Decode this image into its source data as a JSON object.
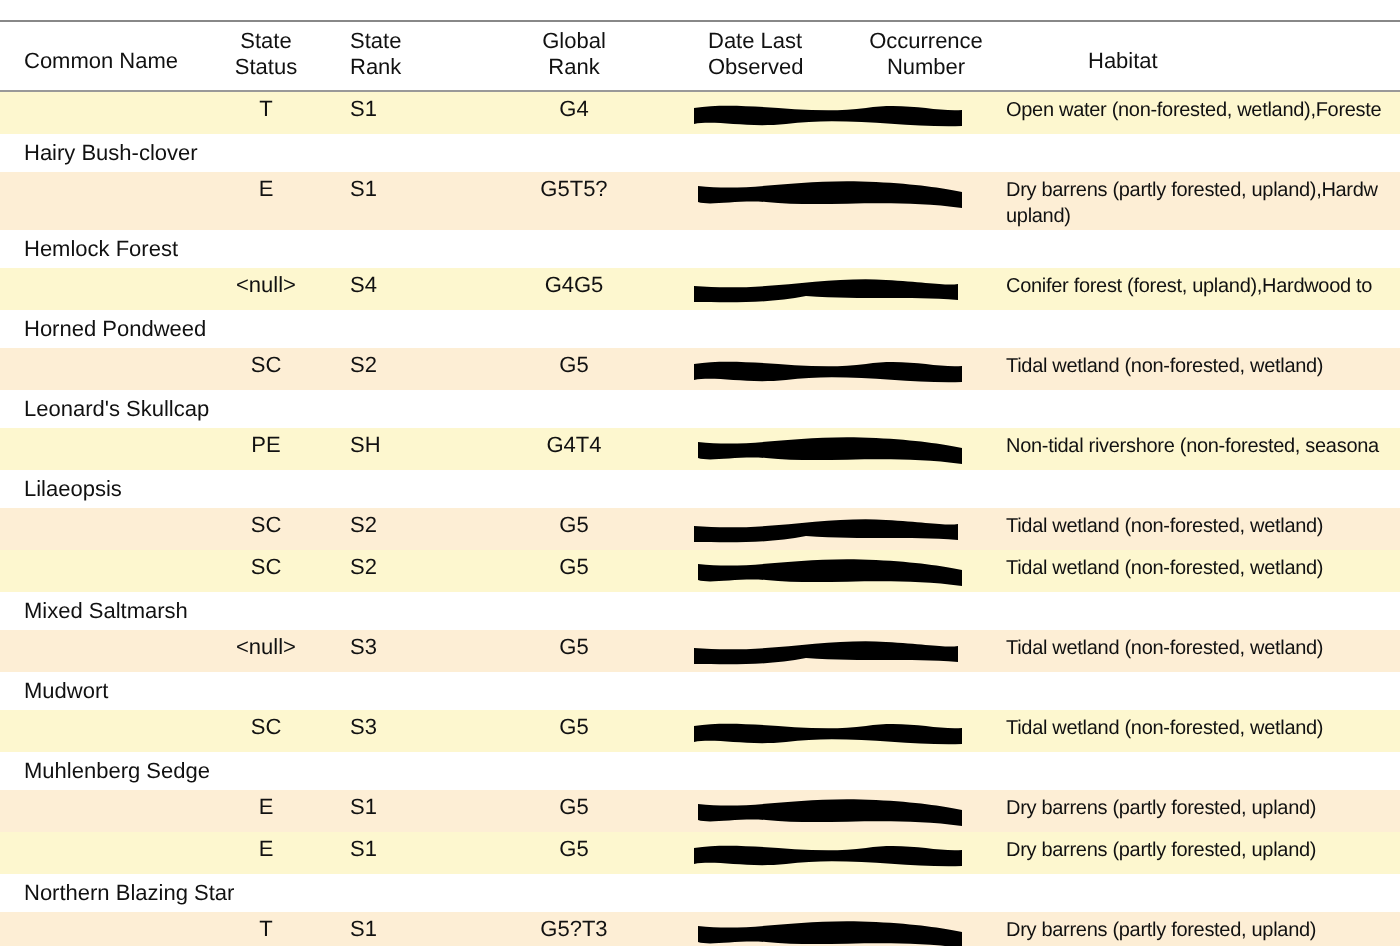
{
  "table": {
    "columns": [
      "Common Name",
      "State Status",
      "State Rank",
      "Global Rank",
      "Date Last Observed",
      "Occurrence Number",
      "Habitat"
    ],
    "rows": [
      {
        "kind": "record",
        "status": "T",
        "state_rank": "S1",
        "global_rank": "G4",
        "redacted": true,
        "habitat": [
          "Open water (non-forested, wetland),Foreste"
        ]
      },
      {
        "kind": "group",
        "name": "Hairy Bush-clover"
      },
      {
        "kind": "record",
        "status": "E",
        "state_rank": "S1",
        "global_rank": "G5T5?",
        "redacted": true,
        "habitat": [
          "Dry barrens (partly forested, upland),Hardw",
          "upland)"
        ]
      },
      {
        "kind": "group",
        "name": "Hemlock Forest"
      },
      {
        "kind": "record",
        "status": "<null>",
        "state_rank": "S4",
        "global_rank": "G4G5",
        "redacted": true,
        "habitat": [
          "Conifer forest (forest, upland),Hardwood to"
        ]
      },
      {
        "kind": "group",
        "name": "Horned Pondweed"
      },
      {
        "kind": "record",
        "status": "SC",
        "state_rank": "S2",
        "global_rank": "G5",
        "redacted": true,
        "habitat": [
          "Tidal wetland (non-forested, wetland)"
        ]
      },
      {
        "kind": "group",
        "name": "Leonard's Skullcap"
      },
      {
        "kind": "record",
        "status": "PE",
        "state_rank": "SH",
        "global_rank": "G4T4",
        "redacted": true,
        "habitat": [
          "Non-tidal rivershore (non-forested, seasona"
        ]
      },
      {
        "kind": "group",
        "name": "Lilaeopsis"
      },
      {
        "kind": "record",
        "status": "SC",
        "state_rank": "S2",
        "global_rank": "G5",
        "redacted": true,
        "habitat": [
          "Tidal wetland (non-forested, wetland)"
        ]
      },
      {
        "kind": "record",
        "status": "SC",
        "state_rank": "S2",
        "global_rank": "G5",
        "redacted": true,
        "habitat": [
          "Tidal wetland (non-forested, wetland)"
        ]
      },
      {
        "kind": "group",
        "name": "Mixed Saltmarsh"
      },
      {
        "kind": "record",
        "status": "<null>",
        "state_rank": "S3",
        "global_rank": "G5",
        "redacted": true,
        "habitat": [
          "Tidal wetland (non-forested, wetland)"
        ]
      },
      {
        "kind": "group",
        "name": "Mudwort"
      },
      {
        "kind": "record",
        "status": "SC",
        "state_rank": "S3",
        "global_rank": "G5",
        "redacted": true,
        "habitat": [
          "Tidal wetland (non-forested, wetland)"
        ]
      },
      {
        "kind": "group",
        "name": "Muhlenberg Sedge"
      },
      {
        "kind": "record",
        "status": "E",
        "state_rank": "S1",
        "global_rank": "G5",
        "redacted": true,
        "habitat": [
          "Dry barrens (partly forested, upland)"
        ]
      },
      {
        "kind": "record",
        "status": "E",
        "state_rank": "S1",
        "global_rank": "G5",
        "redacted": true,
        "habitat": [
          "Dry barrens (partly forested, upland)"
        ]
      },
      {
        "kind": "group",
        "name": "Northern Blazing Star"
      },
      {
        "kind": "record",
        "status": "T",
        "state_rank": "S1",
        "global_rank": "G5?T3",
        "redacted": true,
        "habitat": [
          "Dry barrens (partly forested, upland)"
        ]
      }
    ]
  }
}
